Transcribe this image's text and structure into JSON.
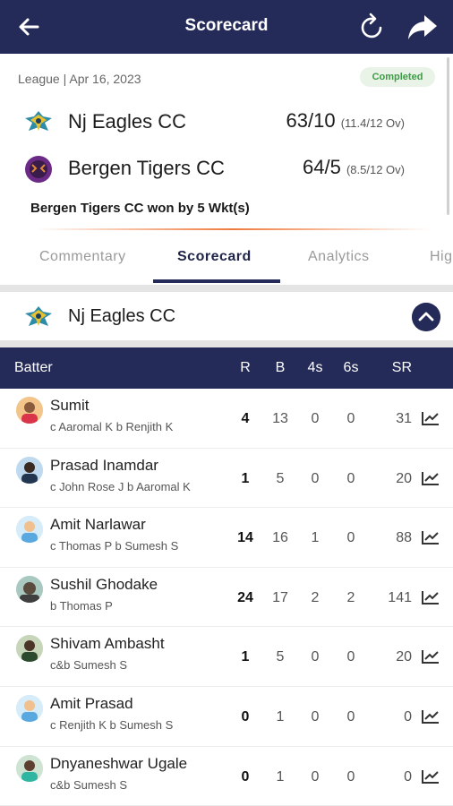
{
  "header": {
    "title": "Scorecard"
  },
  "match": {
    "meta": "League | Apr 16, 2023",
    "status": "Completed",
    "teams": [
      {
        "name": "Nj Eagles CC",
        "score": "63/10",
        "overs": "(11.4/12 Ov)"
      },
      {
        "name": "Bergen Tigers CC",
        "score": "64/5",
        "overs": "(8.5/12 Ov)"
      }
    ],
    "result": "Bergen Tigers CC won by 5 Wkt(s)"
  },
  "tabs": [
    "Commentary",
    "Scorecard",
    "Analytics",
    "Hig"
  ],
  "active_tab": "Scorecard",
  "innings": {
    "team": "Nj Eagles CC"
  },
  "table": {
    "headers": {
      "batter": "Batter",
      "r": "R",
      "b": "B",
      "fours": "4s",
      "sixes": "6s",
      "sr": "SR"
    },
    "rows": [
      {
        "name": "Sumit",
        "dismissal": "c Aaromal K b Renjith K",
        "r": "4",
        "b": "13",
        "fours": "0",
        "sixes": "0",
        "sr": "31"
      },
      {
        "name": "Prasad Inamdar",
        "dismissal": "c John Rose J b Aaromal K",
        "r": "1",
        "b": "5",
        "fours": "0",
        "sixes": "0",
        "sr": "20"
      },
      {
        "name": "Amit Narlawar",
        "dismissal": "c Thomas P b Sumesh S",
        "r": "14",
        "b": "16",
        "fours": "1",
        "sixes": "0",
        "sr": "88"
      },
      {
        "name": "Sushil Ghodake",
        "dismissal": "b Thomas P",
        "r": "24",
        "b": "17",
        "fours": "2",
        "sixes": "2",
        "sr": "141"
      },
      {
        "name": "Shivam Ambasht",
        "dismissal": "c&b Sumesh S",
        "r": "1",
        "b": "5",
        "fours": "0",
        "sixes": "0",
        "sr": "20"
      },
      {
        "name": "Amit Prasad",
        "dismissal": "c Renjith K b Sumesh S",
        "r": "0",
        "b": "1",
        "fours": "0",
        "sixes": "0",
        "sr": "0"
      },
      {
        "name": "Dnyaneshwar Ugale",
        "dismissal": "c&b Sumesh S",
        "r": "0",
        "b": "1",
        "fours": "0",
        "sixes": "0",
        "sr": "0"
      }
    ]
  },
  "colors": {
    "primary": "#252b58",
    "accent": "#ef7a3d",
    "completed": "#3d9b45"
  },
  "icons": [
    "back-arrow-icon",
    "refresh-icon",
    "share-icon",
    "team-logo-icon",
    "collapse-chevron-icon",
    "player-avatar-icon",
    "stats-chart-icon"
  ]
}
